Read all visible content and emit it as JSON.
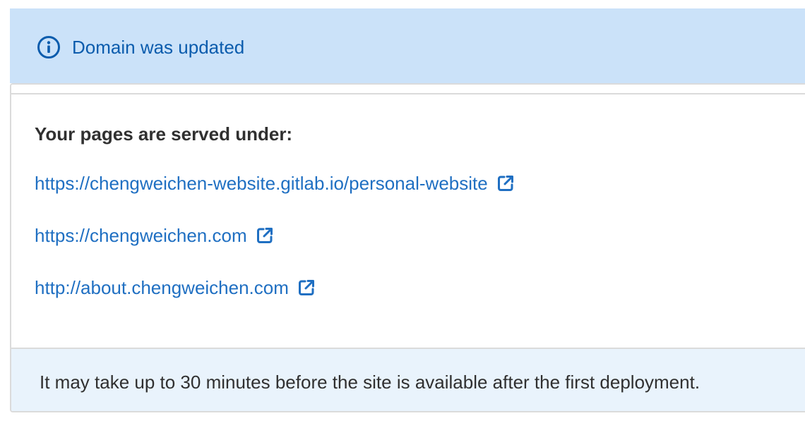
{
  "flash": {
    "icon": "info-circle-icon",
    "message": "Domain was updated",
    "background": "#cbe2f9",
    "text_color": "#0b5cad"
  },
  "pages": {
    "heading": "Your pages are served under:",
    "urls": [
      {
        "href": "https://chengweichen-website.gitlab.io/personal-website",
        "label": "https://chengweichen-website.gitlab.io/personal-website",
        "icon": "external-link-icon"
      },
      {
        "href": "https://chengweichen.com",
        "label": "https://chengweichen.com",
        "icon": "external-link-icon"
      },
      {
        "href": "http://about.chengweichen.com",
        "label": "http://about.chengweichen.com",
        "icon": "external-link-icon"
      }
    ],
    "link_color": "#1f6fc2"
  },
  "footer": {
    "note": "It may take up to 30 minutes before the site is available after the first deployment.",
    "background": "#e9f3fc"
  }
}
